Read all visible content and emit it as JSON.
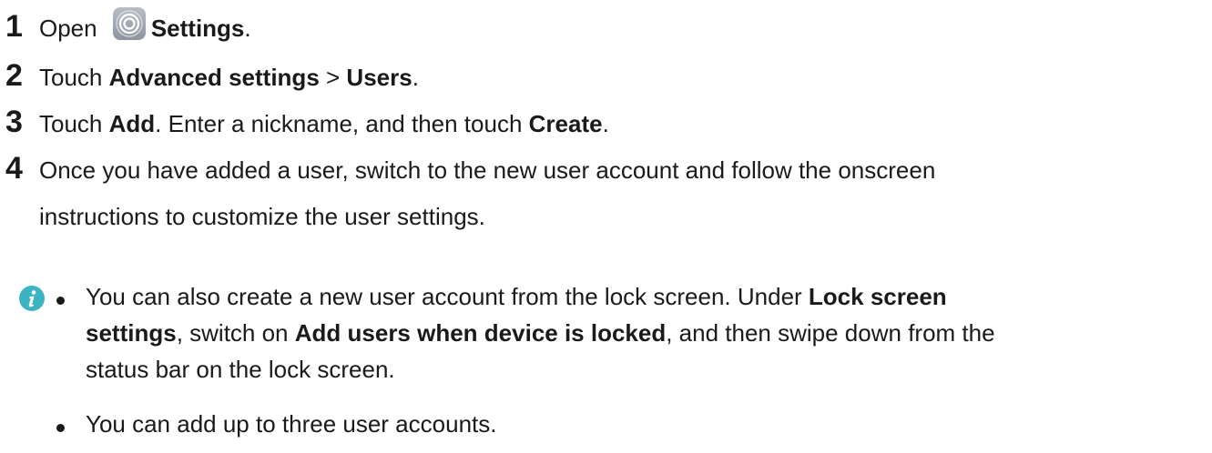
{
  "steps": [
    {
      "number": "1",
      "parts": [
        "Open ",
        "Settings",
        "."
      ],
      "icon": "settings-gear-icon"
    },
    {
      "number": "2",
      "parts": [
        "Touch ",
        "Advanced settings",
        " > ",
        "Users",
        "."
      ]
    },
    {
      "number": "3",
      "parts": [
        "Touch ",
        "Add",
        ". Enter a nickname, and then touch ",
        "Create",
        "."
      ]
    },
    {
      "number": "4",
      "line1": "Once you have added a user, switch to the new user account and follow the onscreen",
      "line2": "instructions to customize the user settings."
    }
  ],
  "note": {
    "icon": "info-icon",
    "icon_color": "#3bb3c3",
    "bullets": [
      {
        "line1_a": "You can also create a new user account from the lock screen. Under ",
        "line1_b": "Lock screen",
        "line2_a": "settings",
        "line2_b": ", switch on ",
        "line2_c": "Add users when device is locked",
        "line2_d": ", and then swipe down from the",
        "line3": "status bar on the lock screen."
      },
      {
        "text": "You can add up to three user accounts."
      }
    ]
  }
}
